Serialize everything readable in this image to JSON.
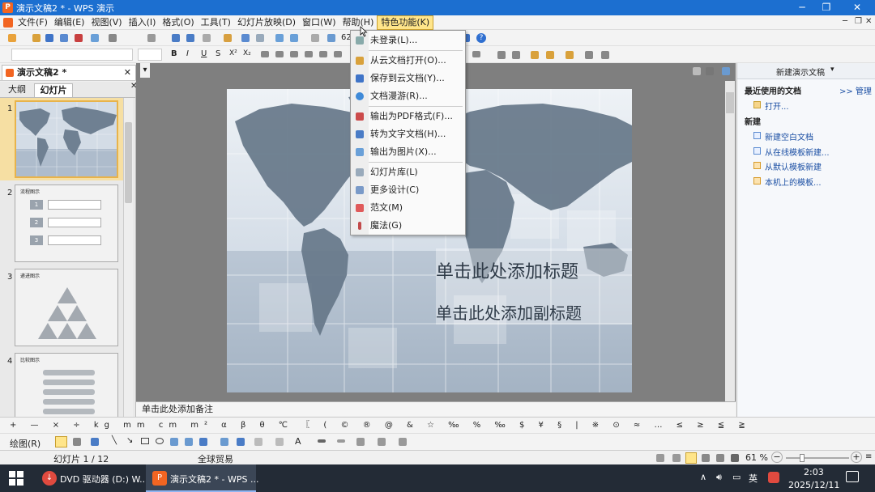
{
  "window": {
    "title": "演示文稿2 * - WPS 演示",
    "app_icon": "wps-presentation-icon"
  },
  "menubar": {
    "items": [
      "文件(F)",
      "编辑(E)",
      "视图(V)",
      "插入(I)",
      "格式(O)",
      "工具(T)",
      "幻灯片放映(D)",
      "窗口(W)",
      "帮助(H)",
      "特色功能(K)"
    ],
    "active_index": 9
  },
  "toolbar": {
    "zoom_value": "62"
  },
  "doc_tab": {
    "title": "演示文稿2 *"
  },
  "left_panel": {
    "tabs": [
      "大纲",
      "幻灯片"
    ],
    "active_tab": 1,
    "thumbnails": [
      {
        "num": "1",
        "caption": ""
      },
      {
        "num": "2",
        "caption": "流程图示",
        "lines": [
          "1",
          "2",
          "3"
        ]
      },
      {
        "num": "3",
        "caption": "递进图示"
      },
      {
        "num": "4",
        "caption": "比较图示"
      }
    ]
  },
  "dropdown": {
    "items": [
      {
        "label": "未登录(L)...",
        "icon": "user-icon"
      },
      {
        "label": "从云文档打开(O)...",
        "icon": "cloud-open-icon"
      },
      {
        "label": "保存到云文档(Y)...",
        "icon": "cloud-save-icon"
      },
      {
        "label": "文档漫游(R)...",
        "icon": "roaming-icon"
      },
      {
        "label": "输出为PDF格式(F)...",
        "icon": "pdf-icon"
      },
      {
        "label": "转为文字文档(H)...",
        "icon": "to-text-icon"
      },
      {
        "label": "输出为图片(X)...",
        "icon": "image-export-icon"
      },
      {
        "label": "幻灯片库(L)",
        "icon": "slide-library-icon"
      },
      {
        "label": "更多设计(C)",
        "icon": "design-icon"
      },
      {
        "label": "范文(M)",
        "icon": "template-icon"
      },
      {
        "label": "魔法(G)",
        "icon": "magic-icon"
      }
    ]
  },
  "slide": {
    "title_placeholder": "单击此处添加标题",
    "subtitle_placeholder": "单击此处添加副标题"
  },
  "notes": {
    "placeholder": "单击此处添加备注"
  },
  "right_panel": {
    "header": "新建演示文稿",
    "recent_heading": "最近使用的文档",
    "manage_link": ">> 管理",
    "open_link": "打开...",
    "new_heading": "新建",
    "new_links": [
      "新建空白文档",
      "从在线模板新建...",
      "从默认模板新建",
      "本机上的模板..."
    ]
  },
  "symbols": "+ — × ÷ kg mm cm m² α β θ ℃ 〖 ( © ® @ & ☆ ‰ % ‰ $ ¥ § | ※ ⊙ ≈ … ≤ ≥ ≦ ≧",
  "drawbar": {
    "label": "绘图(R)"
  },
  "status": {
    "slide_info": "幻灯片 1 / 12",
    "theme": "全球贸易",
    "zoom": "61 %"
  },
  "taskbar": {
    "items": [
      {
        "label": "DVD 驱动器 (D:) W...",
        "icon": "dvd-drive-icon"
      },
      {
        "label": "演示文稿2 * - WPS ...",
        "icon": "wps-presentation-icon"
      }
    ],
    "ime": "英",
    "time": "2:03",
    "date": "2025/12/11"
  },
  "colors": {
    "titlebar": "#1c6fd0",
    "menu_active": "#ffe58a",
    "thumb_selected": "#e8b34a",
    "workspace": "#7f7f7f",
    "taskbar": "#232b36"
  }
}
